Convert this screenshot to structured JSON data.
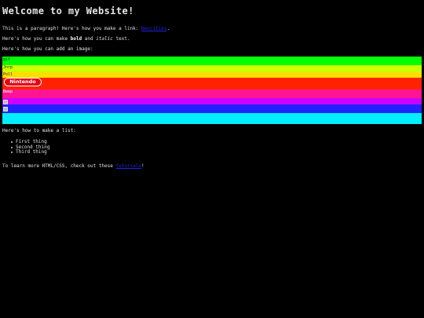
{
  "title": "Welcome to my Website!",
  "para1": {
    "text": "This is a paragraph! Here's how you make a link: ",
    "link": "Neocities",
    "end": "."
  },
  "para2": {
    "before": "Here's how you can make ",
    "bold": "bold",
    "middle": " and ",
    "italic": "italic",
    "after": " text."
  },
  "para3": "Here's how you can add an image:",
  "rainbow": {
    "colors": [
      "#00ff00",
      "#ccff00",
      "#ffdd00",
      "#ff2200",
      "#ff1493",
      "#cc00ff",
      "#2222ff",
      "#00eeff",
      "#00ff22"
    ],
    "labels": [
      "gif",
      "Jnrp",
      "Poll",
      "Nintendo"
    ],
    "logo_text": "Nintendo",
    "alt_text": "Beep"
  },
  "para4": "Here's how to make a list:",
  "list": [
    "First thing",
    "Second thing",
    "Third thing"
  ],
  "para5": {
    "text": "To learn more HTML/CSS, check out these ",
    "link": "tutorials",
    "end": "!"
  }
}
